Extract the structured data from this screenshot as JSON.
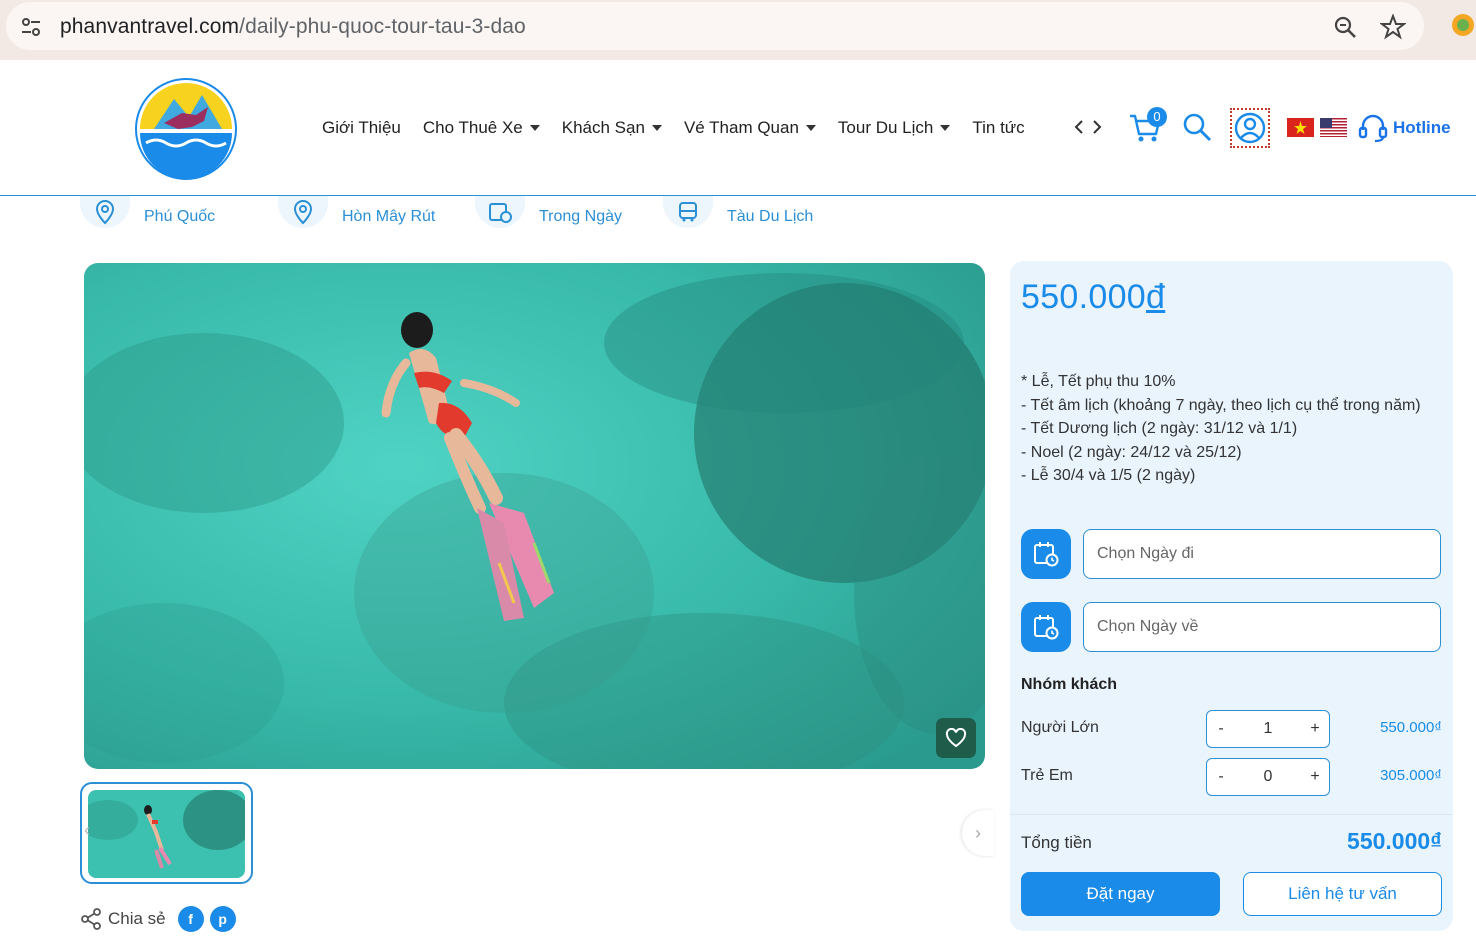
{
  "browser": {
    "url_domain": "phanvantravel.com",
    "url_path": "/daily-phu-quoc-tour-tau-3-dao"
  },
  "nav": {
    "items": [
      {
        "label": "Giới Thiệu"
      },
      {
        "label": "Cho Thuê Xe"
      },
      {
        "label": "Khách Sạn"
      },
      {
        "label": "Vé Tham Quan"
      },
      {
        "label": "Tour Du Lịch"
      },
      {
        "label": "Tin tức"
      }
    ],
    "cart_count": "0",
    "hotline_label": "Hotline"
  },
  "tags": [
    {
      "label": "Phú Quốc",
      "icon": "location-pin-icon"
    },
    {
      "label": "Hòn Mây Rút",
      "icon": "location-pin-icon"
    },
    {
      "label": "Trong Ngày",
      "icon": "calendar-clock-icon"
    },
    {
      "label": "Tàu Du Lịch",
      "icon": "bus-icon"
    }
  ],
  "share": {
    "label": "Chia sẻ",
    "facebook": "f",
    "pinterest": "p"
  },
  "booking": {
    "price": "550.000",
    "currency": "đ",
    "notes": [
      "* Lễ, Tết phụ thu 10%",
      "- Tết âm lịch (khoảng 7 ngày, theo lịch cụ thể trong năm)",
      "- Tết Dương lịch (2 ngày: 31/12 và 1/1)",
      "- Noel (2 ngày: 24/12 và 25/12)",
      "- Lễ 30/4 và 1/5 (2 ngày)"
    ],
    "depart_placeholder": "Chọn Ngày đi",
    "return_placeholder": "Chọn Ngày về",
    "group_title": "Nhóm khách",
    "guests": [
      {
        "label": "Người Lớn",
        "count": "1",
        "price": "550.000₫"
      },
      {
        "label": "Trẻ Em",
        "count": "0",
        "price": "305.000₫"
      }
    ],
    "minus": "-",
    "plus": "+",
    "total_label": "Tổng tiền",
    "total_value": "550.000₫",
    "book_label": "Đặt ngay",
    "contact_label": "Liên hệ tư vấn"
  },
  "colors": {
    "primary": "#1a8be8",
    "panel_bg": "#e9f4fd",
    "water": "#3cc0b0"
  }
}
